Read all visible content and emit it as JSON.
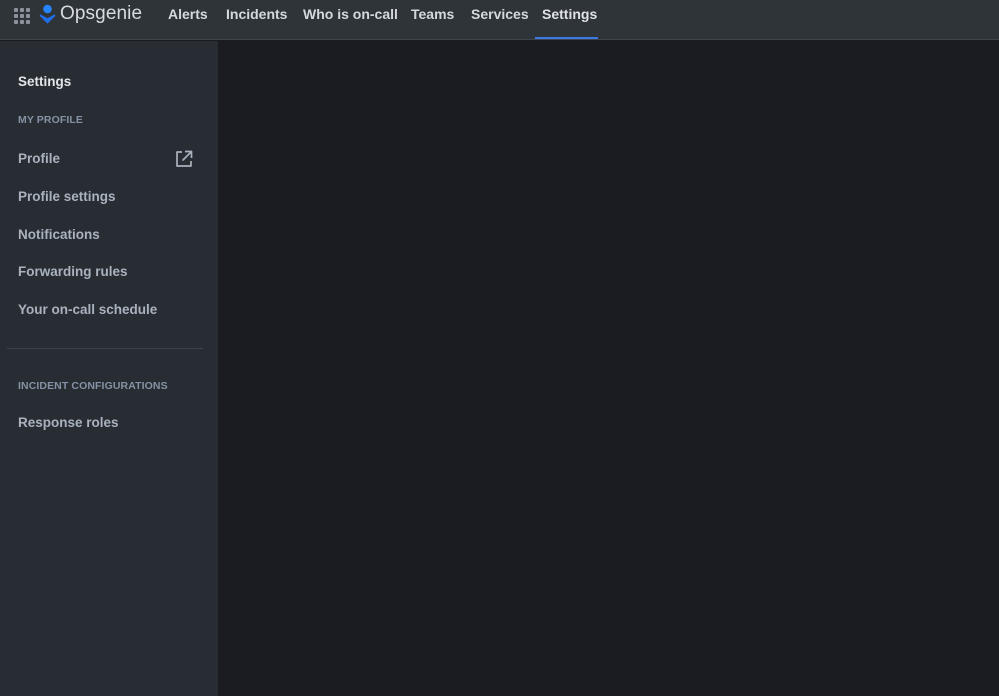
{
  "topbar": {
    "app_name": "Opsgenie",
    "nav": [
      {
        "label": "Alerts"
      },
      {
        "label": "Incidents"
      },
      {
        "label": "Who is on-call"
      },
      {
        "label": "Teams"
      },
      {
        "label": "Services"
      },
      {
        "label": "Settings",
        "active": true
      }
    ],
    "icons": {
      "app_switcher": "app-switcher-grid-icon",
      "logo": "opsgenie-logo-icon"
    }
  },
  "sidebar": {
    "title": "Settings",
    "sections": [
      {
        "heading": "MY PROFILE",
        "items": [
          {
            "label": "Profile",
            "icon": "external-link-icon"
          },
          {
            "label": "Profile settings"
          },
          {
            "label": "Notifications"
          },
          {
            "label": "Forwarding rules"
          },
          {
            "label": "Your on-call schedule"
          }
        ]
      },
      {
        "heading": "INCIDENT CONFIGURATIONS",
        "items": [
          {
            "label": "Response roles"
          }
        ]
      }
    ]
  },
  "colors": {
    "topbar_bg": "#2f3439",
    "sidebar_bg": "#282d34",
    "main_bg": "#1b1c21",
    "accent": "#3a78e3",
    "logo_blue": "#2684ff"
  }
}
